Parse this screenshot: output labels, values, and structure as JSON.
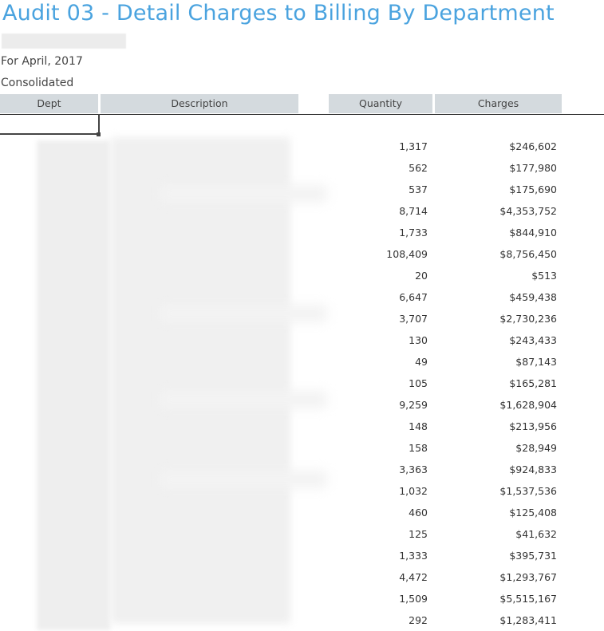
{
  "report": {
    "title": "Audit 03 - Detail Charges to Billing By Department",
    "period": "For April, 2017",
    "scope": "Consolidated"
  },
  "columns": {
    "dept": "Dept",
    "description": "Description",
    "quantity": "Quantity",
    "charges": "Charges"
  },
  "rows": [
    {
      "quantity": "1,317",
      "charges": "$246,602"
    },
    {
      "quantity": "562",
      "charges": "$177,980"
    },
    {
      "quantity": "537",
      "charges": "$175,690"
    },
    {
      "quantity": "8,714",
      "charges": "$4,353,752"
    },
    {
      "quantity": "1,733",
      "charges": "$844,910"
    },
    {
      "quantity": "108,409",
      "charges": "$8,756,450"
    },
    {
      "quantity": "20",
      "charges": "$513"
    },
    {
      "quantity": "6,647",
      "charges": "$459,438"
    },
    {
      "quantity": "3,707",
      "charges": "$2,730,236"
    },
    {
      "quantity": "130",
      "charges": "$243,433"
    },
    {
      "quantity": "49",
      "charges": "$87,143"
    },
    {
      "quantity": "105",
      "charges": "$165,281"
    },
    {
      "quantity": "9,259",
      "charges": "$1,628,904"
    },
    {
      "quantity": "148",
      "charges": "$213,956"
    },
    {
      "quantity": "158",
      "charges": "$28,949"
    },
    {
      "quantity": "3,363",
      "charges": "$924,833"
    },
    {
      "quantity": "1,032",
      "charges": "$1,537,536"
    },
    {
      "quantity": "460",
      "charges": "$125,408"
    },
    {
      "quantity": "125",
      "charges": "$41,632"
    },
    {
      "quantity": "1,333",
      "charges": "$395,731"
    },
    {
      "quantity": "4,472",
      "charges": "$1,293,767"
    },
    {
      "quantity": "1,509",
      "charges": "$5,515,167"
    },
    {
      "quantity": "292",
      "charges": "$1,283,411"
    }
  ],
  "colors": {
    "title": "#4aa3df",
    "header_bg": "#d4dade"
  }
}
